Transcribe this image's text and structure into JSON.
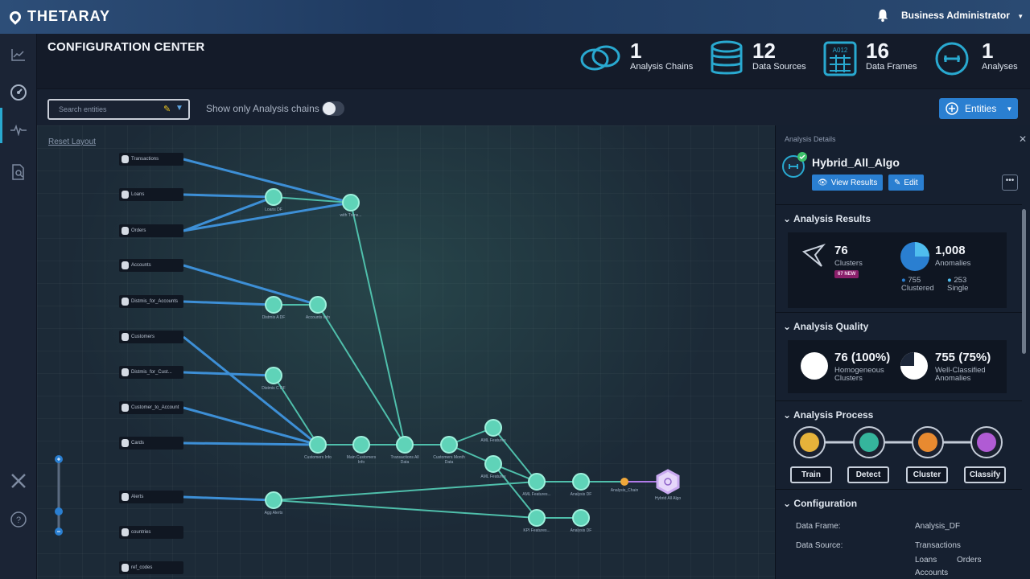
{
  "app": {
    "brand": "THETARAY",
    "user": "Business Administrator"
  },
  "header": {
    "title": "CONFIGURATION CENTER",
    "stats": [
      {
        "value": "1",
        "label": "Analysis Chains",
        "icon": "chain-icon"
      },
      {
        "value": "12",
        "label": "Data Sources",
        "icon": "database-icon"
      },
      {
        "value": "16",
        "label": "Data Frames",
        "icon": "dataframe-icon"
      },
      {
        "value": "1",
        "label": "Analyses",
        "icon": "analysis-icon"
      }
    ]
  },
  "toolbar": {
    "search_placeholder": "Search entities",
    "toggle_label": "Show only Analysis chains",
    "toggle_on": false,
    "entities_button": "Entities"
  },
  "canvas": {
    "reset_layout": "Reset Layout",
    "entities": [
      "Transactions",
      "Loans",
      "Orders",
      "Accounts",
      "Distmis_for_Accounts",
      "Customers",
      "Distmis_for_Cust...",
      "Customer_to_Account",
      "Cards",
      "Alerts",
      "countries",
      "ref_codes"
    ],
    "node_labels": {
      "n1": "Loans DF",
      "n2": "with Trans...",
      "n3": "Distmis A DF",
      "n4": "Accounts Info",
      "n5": "Distmis C DF",
      "n6": "Customers Info",
      "n7": "Main Customers Info",
      "n8": "Transactions All Data",
      "n9": "Customers Month Data",
      "n10": "AML Features",
      "n11": "AML Features",
      "n12": "Agg Alerts",
      "n13": "AML Features...",
      "n14": "Analysis DF",
      "n15": "Analysis_Chain",
      "n16": "Hybrid All Algo",
      "n17": "KPI Features...",
      "n18": "Analysis DF"
    }
  },
  "panel": {
    "header": "Analysis Details",
    "analysis_name": "Hybrid_All_Algo",
    "view_results": "View Results",
    "edit": "Edit",
    "results": {
      "title": "Analysis Results",
      "clusters": "76",
      "clusters_label": "Clusters",
      "new_badge": "67 NEW",
      "anomalies": "1,008",
      "anomalies_label": "Anomalies",
      "clustered": "755",
      "clustered_label": "Clustered",
      "single": "253",
      "single_label": "Single"
    },
    "quality": {
      "title": "Analysis Quality",
      "homog_value": "76 (100%)",
      "homog_label1": "Homogeneous",
      "homog_label2": "Clusters",
      "wellc_value": "755 (75%)",
      "wellc_label1": "Well-Classified",
      "wellc_label2": "Anomalies"
    },
    "process": {
      "title": "Analysis Process",
      "steps": [
        "Train",
        "Detect",
        "Cluster",
        "Classify"
      ]
    },
    "configuration": {
      "title": "Configuration",
      "data_frame_label": "Data Frame:",
      "data_frame": "Analysis_DF",
      "data_source_label": "Data Source:",
      "ds1": "Transactions",
      "ds2": "Loans",
      "ds3": "Orders",
      "ds4": "Accounts"
    }
  },
  "colors": {
    "accent": "#2a7fd1",
    "node": "#5fd3b8",
    "edge_blue": "#3d8fd6",
    "edge_teal": "#4fbfab",
    "final_node": "#c9a9f0"
  }
}
